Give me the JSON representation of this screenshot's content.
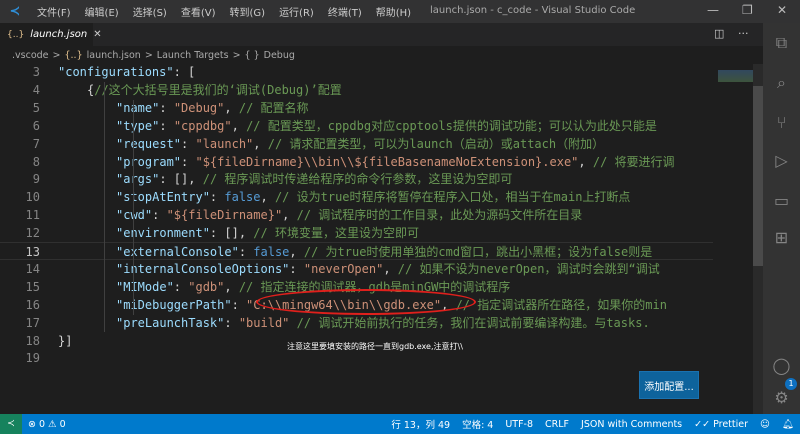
{
  "titlebar": {
    "menus": [
      "文件(F)",
      "编辑(E)",
      "选择(S)",
      "查看(V)",
      "转到(G)",
      "运行(R)",
      "终端(T)",
      "帮助(H)"
    ],
    "title": "launch.json - c_code - Visual Studio Code",
    "minimize": "—",
    "restore": "❐",
    "close": "✕"
  },
  "tab": {
    "icon": "{..}",
    "label": "launch.json",
    "close": "✕",
    "split": "◫",
    "more": "···"
  },
  "breadcrumb": {
    "items": [
      ".vscode",
      "launch.json",
      "Launch Targets",
      "Debug"
    ],
    "sep": ">",
    "json_icon": "{..}",
    "obj_icon": "{ }"
  },
  "editor": {
    "current_line": 13,
    "lines": [
      {
        "n": 3,
        "indent": 1,
        "t": [
          [
            "k",
            "\"configurations\""
          ],
          [
            "p",
            ": ["
          ]
        ]
      },
      {
        "n": 4,
        "indent": 2,
        "t": [
          [
            "p",
            "{"
          ],
          [
            "c",
            "//这个大括号里是我们的‘调试(Debug)’配置"
          ]
        ]
      },
      {
        "n": 5,
        "indent": 3,
        "t": [
          [
            "k",
            "\"name\""
          ],
          [
            "p",
            ": "
          ],
          [
            "s",
            "\"Debug\""
          ],
          [
            "p",
            ", "
          ],
          [
            "c",
            "// 配置名称"
          ]
        ]
      },
      {
        "n": 6,
        "indent": 3,
        "t": [
          [
            "k",
            "\"type\""
          ],
          [
            "p",
            ": "
          ],
          [
            "s",
            "\"cppdbg\""
          ],
          [
            "p",
            ", "
          ],
          [
            "c",
            "// 配置类型，cppdbg对应cpptools提供的调试功能；可以认为此处只能是"
          ]
        ]
      },
      {
        "n": 7,
        "indent": 3,
        "t": [
          [
            "k",
            "\"request\""
          ],
          [
            "p",
            ": "
          ],
          [
            "s",
            "\"launch\""
          ],
          [
            "p",
            ", "
          ],
          [
            "c",
            "// 请求配置类型，可以为launch（启动）或attach（附加）"
          ]
        ]
      },
      {
        "n": 8,
        "indent": 3,
        "t": [
          [
            "k",
            "\"program\""
          ],
          [
            "p",
            ": "
          ],
          [
            "s",
            "\"${fileDirname}\\\\bin\\\\${fileBasenameNoExtension}.exe\""
          ],
          [
            "p",
            ", "
          ],
          [
            "c",
            "// 将要进行调"
          ]
        ]
      },
      {
        "n": 9,
        "indent": 3,
        "t": [
          [
            "k",
            "\"args\""
          ],
          [
            "p",
            ": [], "
          ],
          [
            "c",
            "// 程序调试时传递给程序的命令行参数，这里设为空即可"
          ]
        ]
      },
      {
        "n": 10,
        "indent": 3,
        "t": [
          [
            "k",
            "\"stopAtEntry\""
          ],
          [
            "p",
            ": "
          ],
          [
            "b",
            "false"
          ],
          [
            "p",
            ", "
          ],
          [
            "c",
            "// 设为true时程序将暂停在程序入口处，相当于在main上打断点"
          ]
        ]
      },
      {
        "n": 11,
        "indent": 3,
        "t": [
          [
            "k",
            "\"cwd\""
          ],
          [
            "p",
            ": "
          ],
          [
            "s",
            "\"${fileDirname}\""
          ],
          [
            "p",
            ", "
          ],
          [
            "c",
            "// 调试程序时的工作目录，此处为源码文件所在目录"
          ]
        ]
      },
      {
        "n": 12,
        "indent": 3,
        "t": [
          [
            "k",
            "\"environment\""
          ],
          [
            "p",
            ": [], "
          ],
          [
            "c",
            "// 环境变量，这里设为空即可"
          ]
        ]
      },
      {
        "n": 13,
        "indent": 3,
        "t": [
          [
            "k",
            "\"externalConsole\""
          ],
          [
            "p",
            ": "
          ],
          [
            "b",
            "false"
          ],
          [
            "p",
            ", "
          ],
          [
            "c",
            "// 为true时使用单独的cmd窗口，跳出小黑框；设为false则是"
          ]
        ]
      },
      {
        "n": 14,
        "indent": 3,
        "t": [
          [
            "k",
            "\"internalConsoleOptions\""
          ],
          [
            "p",
            ": "
          ],
          [
            "s",
            "\"neverOpen\""
          ],
          [
            "p",
            ", "
          ],
          [
            "c",
            "// 如果不设为neverOpen，调试时会跳到“调试"
          ]
        ]
      },
      {
        "n": 15,
        "indent": 3,
        "t": [
          [
            "k",
            "\"MIMode\""
          ],
          [
            "p",
            ": "
          ],
          [
            "s",
            "\"gdb\""
          ],
          [
            "p",
            ", "
          ],
          [
            "c",
            "// 指定连接的调试器，gdb是minGW中的调试程序"
          ]
        ]
      },
      {
        "n": 16,
        "indent": 3,
        "t": [
          [
            "k",
            "\"miDebuggerPath\""
          ],
          [
            "p",
            ": "
          ],
          [
            "s",
            "\"C:\\\\mingw64\\\\bin\\\\gdb.exe\""
          ],
          [
            "p",
            ", "
          ],
          [
            "c",
            "// 指定调试器所在路径，如果你的min"
          ]
        ]
      },
      {
        "n": 17,
        "indent": 3,
        "t": [
          [
            "k",
            "\"preLaunchTask\""
          ],
          [
            "p",
            ": "
          ],
          [
            "s",
            "\"build\""
          ],
          [
            "p",
            " "
          ],
          [
            "c",
            "// 调试开始前执行的任务，我们在调试前要编译构建。与tasks."
          ]
        ]
      },
      {
        "n": 18,
        "indent": 1,
        "t": [
          [
            "p",
            "}]"
          ]
        ]
      },
      {
        "n": 19,
        "indent": 0,
        "t": []
      }
    ]
  },
  "annotation": "注意这里要填安装的路径一直到gdb.exe,注意打\\\\",
  "add_config_button": "添加配置...",
  "activity": {
    "account_badge": "1"
  },
  "status": {
    "remote": "≺",
    "errors": "0",
    "warnings": "0",
    "position": "行 13，列 49",
    "spaces": "空格: 4",
    "encoding": "UTF-8",
    "eol": "CRLF",
    "language": "JSON with Comments",
    "prettier": "✓✓ Prettier"
  },
  "colors": {
    "accent": "#007acc",
    "annotation_circle": "#e0201c",
    "button": "#0e639c"
  }
}
